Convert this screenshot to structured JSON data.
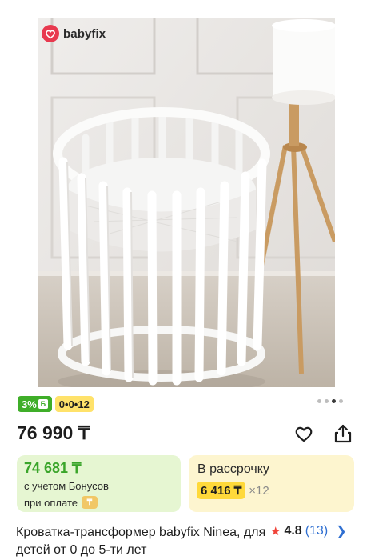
{
  "brand": {
    "name": "babyfix",
    "icon": "heart-logo-icon"
  },
  "gallery": {
    "slides": 4,
    "active_index": 2
  },
  "badges": {
    "bonus": {
      "text": "3%",
      "icon": "bonus-b-icon",
      "color": "#3fae29"
    },
    "installment": {
      "text": "0•0•12",
      "color": "#ffe26a"
    }
  },
  "price": {
    "main": "76 990 ₸"
  },
  "actions": {
    "favorite_icon": "heart-outline-icon",
    "share_icon": "share-icon"
  },
  "bonus_card": {
    "price": "74 681 ₸",
    "line1": "с учетом Бонусов",
    "line2": "при оплате",
    "color": "#e6f6d2"
  },
  "installment_card": {
    "title": "В рассрочку",
    "amount": "6 416 ₸",
    "multiplier": "×12",
    "color": "#fdf5cf"
  },
  "product": {
    "title": "Кроватка-трансформер babyfix Ninea, для детей от 0 до 5-ти лет"
  },
  "rating": {
    "value": "4.8",
    "reviews": "(13)",
    "icon": "star-icon"
  }
}
